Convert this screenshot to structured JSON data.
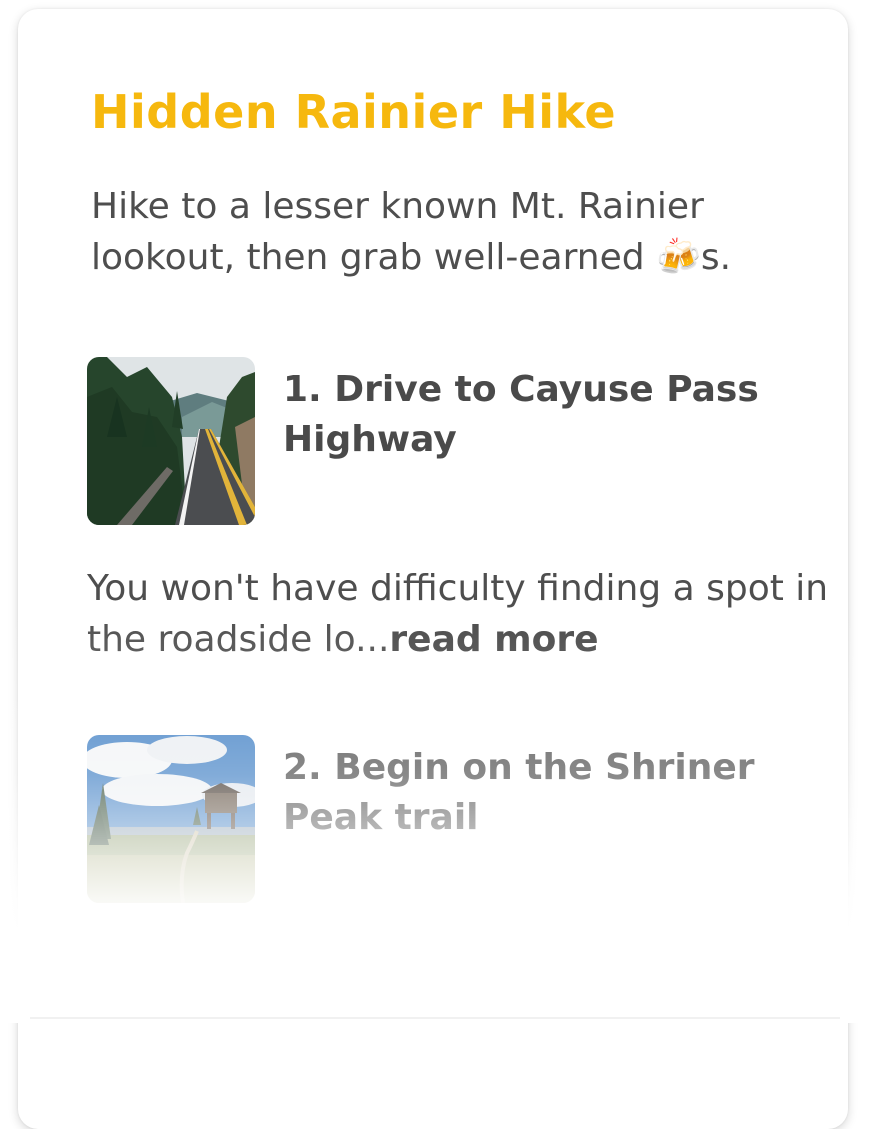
{
  "card": {
    "title": "Hidden Rainier Hike",
    "description": "Hike to a lesser known Mt. Rainier lookout, then grab well-earned 🍻s."
  },
  "steps": [
    {
      "title": "1. Drive to Cayuse Pass Highway",
      "excerpt": "You won't have difficulty finding a spot in the roadside lo...",
      "read_more": "read more",
      "image": "mountain-highway-photo"
    },
    {
      "title": "2. Begin on the Shriner Peak trail",
      "image": "fire-lookout-trail-photo"
    }
  ],
  "colors": {
    "title": "#f6b80e",
    "text": "#4e4e4e"
  }
}
